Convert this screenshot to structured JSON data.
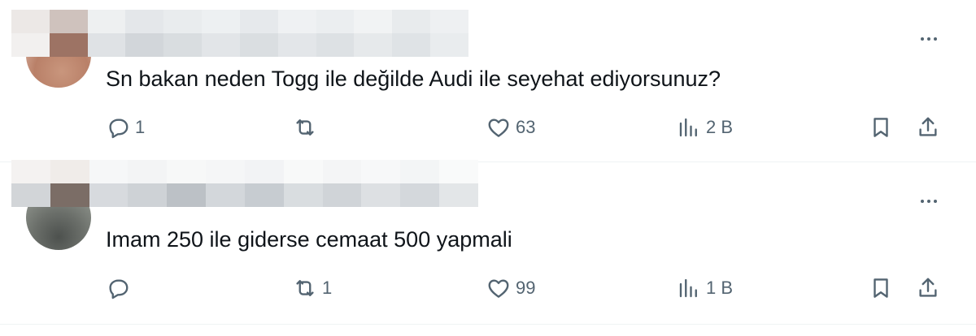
{
  "tweets": [
    {
      "text": "Sn bakan neden Togg ile değilde Audi ile seyehat ediyorsunuz?",
      "replies": "1",
      "retweets": "",
      "likes": "63",
      "views": "2 B"
    },
    {
      "text": "Imam 250 ile giderse cemaat 500 yapmali",
      "replies": "",
      "retweets": "1",
      "likes": "99",
      "views": "1 B"
    }
  ],
  "icons": {
    "more": "more-dots-icon",
    "reply": "reply-icon",
    "retweet": "retweet-icon",
    "like": "heart-icon",
    "views": "views-chart-icon",
    "bookmark": "bookmark-icon",
    "share": "share-icon"
  },
  "colors": {
    "icon_gray": "#536471",
    "text": "#0f1419",
    "divider": "#eff3f4"
  }
}
